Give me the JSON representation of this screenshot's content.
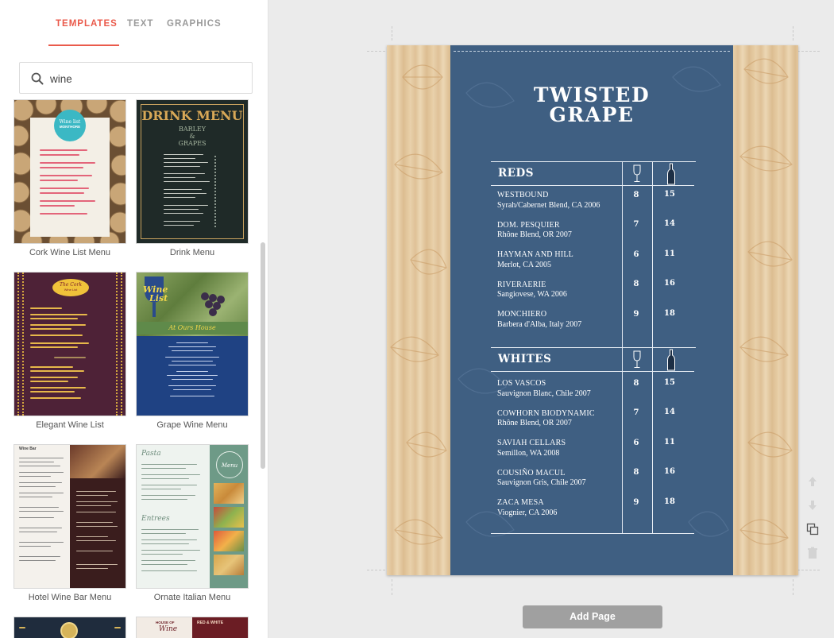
{
  "sidebar": {
    "tabs": [
      {
        "label": "TEMPLATES"
      },
      {
        "label": "TEXT"
      },
      {
        "label": "GRAPHICS"
      }
    ],
    "search": {
      "value": "wine"
    },
    "templates": [
      {
        "name": "Cork Wine List Menu"
      },
      {
        "name": "Drink Menu"
      },
      {
        "name": "Elegant Wine List"
      },
      {
        "name": "Grape Wine Menu"
      },
      {
        "name": "Hotel Wine Bar Menu"
      },
      {
        "name": "Ornate Italian Menu"
      }
    ],
    "thumb_text": {
      "cork_badge_top": "Wine list",
      "cork_badge_bottom": "MONTHORE",
      "drink_title": "DRINK MENU",
      "drink_sub1": "BARLEY",
      "drink_sub2": "&",
      "drink_sub3": "GRAPES",
      "elegant_badge1": "The Cork",
      "elegant_badge2": "Wine List",
      "grape_title1": "Wine",
      "grape_title2": "List",
      "grape_sub": "At Ours House",
      "hotel_title": "Wine Bar",
      "ornate_title1": "Pasta",
      "ornate_title2": "Entrees",
      "ornate_side": "Menu",
      "house_1": "HOUSE OF",
      "house_2": "Wine",
      "red_white": "RED & WHITE"
    }
  },
  "menu": {
    "title_line1": "TWISTED",
    "title_line2": "GRAPE",
    "sections": [
      {
        "title": "REDS",
        "wines": [
          {
            "name": "WESTBOUND",
            "desc": "Syrah/Cabernet Blend, CA 2006",
            "glass": "8",
            "bottle": "15"
          },
          {
            "name": "DOM. PESQUIER",
            "desc": "Rhône Blend, OR 2007",
            "glass": "7",
            "bottle": "14"
          },
          {
            "name": "HAYMAN AND HILL",
            "desc": "Merlot, CA 2005",
            "glass": "6",
            "bottle": "11"
          },
          {
            "name": "RIVERAERIE",
            "desc": "Sangiovese, WA 2006",
            "glass": "8",
            "bottle": "16"
          },
          {
            "name": "MONCHIERO",
            "desc": "Barbera d'Alba, Italy 2007",
            "glass": "9",
            "bottle": "18"
          }
        ]
      },
      {
        "title": "WHITES",
        "wines": [
          {
            "name": "LOS VASCOS",
            "desc": "Sauvignon Blanc, Chile 2007",
            "glass": "8",
            "bottle": "15"
          },
          {
            "name": "COWHORN BIODYNAMIC",
            "desc": "Rhône Blend, OR 2007",
            "glass": "7",
            "bottle": "14"
          },
          {
            "name": "SAVIAH CELLARS",
            "desc": "Semillon, WA 2008",
            "glass": "6",
            "bottle": "11"
          },
          {
            "name": "COUSIÑO MACUL",
            "desc": "Sauvignon Gris, Chile 2007",
            "glass": "8",
            "bottle": "16"
          },
          {
            "name": "ZACA MESA",
            "desc": "Viognier, CA 2006",
            "glass": "9",
            "bottle": "18"
          }
        ]
      }
    ]
  },
  "canvas": {
    "add_page_label": "Add Page",
    "side_icons": [
      "arrow-up-icon",
      "arrow-down-icon",
      "duplicate-icon",
      "trash-icon"
    ]
  }
}
